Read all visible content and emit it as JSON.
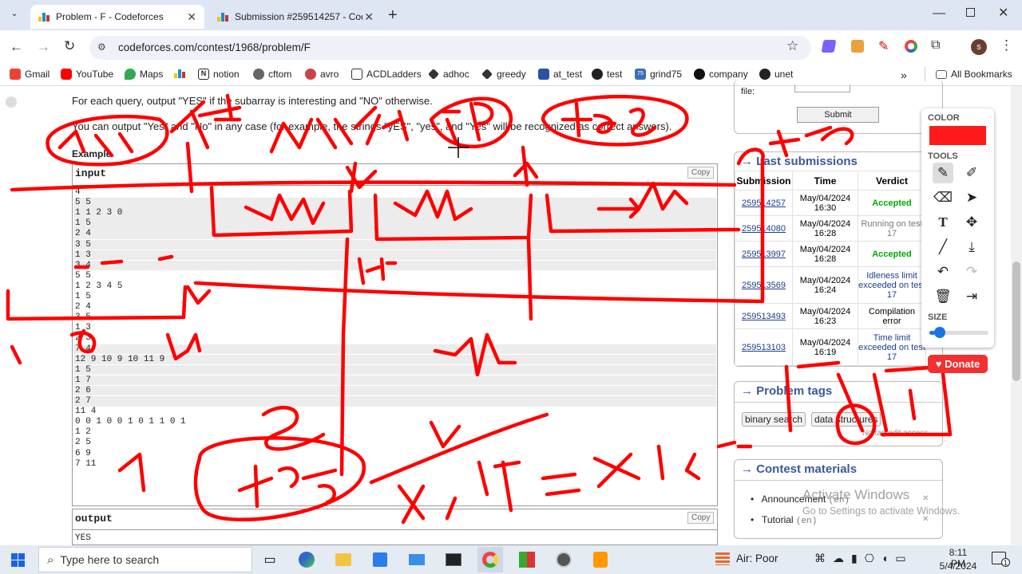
{
  "tabs": [
    {
      "title": "Problem - F - Codeforces",
      "active": true
    },
    {
      "title": "Submission #259514257 - Code",
      "active": false
    }
  ],
  "address": {
    "url": "codeforces.com/contest/1968/problem/F"
  },
  "bookmarks": [
    "Gmail",
    "YouTube",
    "Maps",
    "",
    "notion",
    "cftom",
    "avro",
    "ACDLadders",
    "adhoc",
    "greedy",
    "at_test",
    "test",
    "grind75",
    "company",
    "unet"
  ],
  "bookmarks_more": "»",
  "all_bookmarks": "All Bookmarks",
  "problem": {
    "para1": "For each query, output \"YES\" if the subarray is interesting and \"NO\" otherwise.",
    "para2": "You can output \"Yes\" and \"No\" in any case (for example, the strings \"yES\", \"yes\", and \"Yes\" will be recognized as correct answers).",
    "example_heading": "Example",
    "input_label": "input",
    "output_label": "output",
    "copy_label": "Copy",
    "input_lines": [
      "4",
      "5 5",
      "1 1 2 3 0",
      "1 5",
      "2 4",
      "3 5",
      "1 3",
      "3 4",
      "5 5",
      "1 2 3 4 5",
      "1 5",
      "2 4",
      "3 5",
      "1 3",
      "2 3",
      "7 4",
      "12 9 10 9 10 11 9",
      "1 5",
      "1 7",
      "2 6",
      "2 7",
      "11 4",
      "0 0 1 0 0 1 0 1 1 0 1",
      "1 2",
      "2 5",
      "6 9",
      "7 11"
    ],
    "output_first": "YES"
  },
  "sidebar": {
    "file_label": "file:",
    "submit_label": "Submit",
    "last_submissions_title": "Last submissions",
    "table_headers": [
      "Submission",
      "Time",
      "Verdict"
    ],
    "rows": [
      {
        "id": "259514257",
        "time": "May/04/2024 16:30",
        "verdict": "Accepted",
        "kind": "acc"
      },
      {
        "id": "259514080",
        "time": "May/04/2024 16:28",
        "verdict": "Running on test 17",
        "kind": "gray"
      },
      {
        "id": "259513997",
        "time": "May/04/2024 16:28",
        "verdict": "Accepted",
        "kind": "acc"
      },
      {
        "id": "259513569",
        "time": "May/04/2024 16:24",
        "verdict": "Idleness limit exceeded on test 17",
        "kind": "blue"
      },
      {
        "id": "259513493",
        "time": "May/04/2024 16:23",
        "verdict": "Compilation error",
        "kind": "plain"
      },
      {
        "id": "259513103",
        "time": "May/04/2024 16:19",
        "verdict": "Time limit exceeded on test 17",
        "kind": "blue"
      }
    ],
    "problem_tags_title": "Problem tags",
    "tags": [
      "binary search",
      "data structures"
    ],
    "no_tag_edit": "No tag edit access",
    "contest_materials_title": "Contest materials",
    "materials": [
      {
        "label": "Announcement",
        "lang": "(en)"
      },
      {
        "label": "Tutorial",
        "lang": "(en)"
      }
    ]
  },
  "draw_tools": {
    "color_label": "COLOR",
    "color": "#ff1a1a",
    "tools_label": "TOOLS",
    "size_label": "SIZE",
    "size_value": 0.1
  },
  "donate_label": "Donate",
  "watermark": {
    "line1": "Activate Windows",
    "line2": "Go to Settings to activate Windows."
  },
  "taskbar": {
    "search_placeholder": "Type here to search",
    "air_quality": "Air: Poor",
    "time": "8:11 PM",
    "date": "5/4/2024",
    "notifications": "1"
  },
  "colors": {
    "ink": "#ff0000",
    "cf_link": "#3b5998",
    "accepted": "#00aa00"
  }
}
